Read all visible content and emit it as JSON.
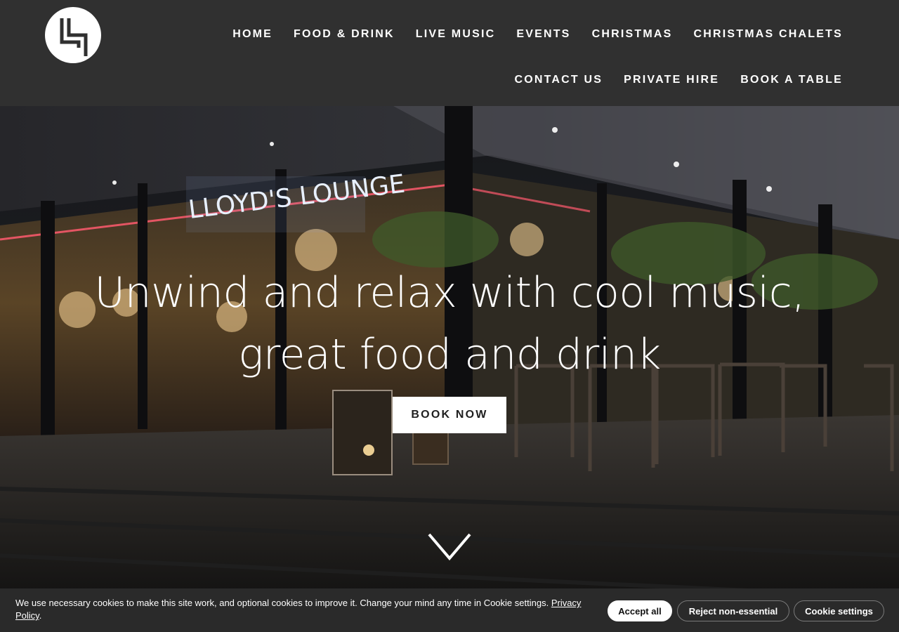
{
  "brand": {
    "logo_icon": "lloyds-lounge-logo-icon"
  },
  "nav": {
    "row1": [
      "HOME",
      "FOOD & DRINK",
      "LIVE MUSIC",
      "EVENTS",
      "CHRISTMAS",
      "CHRISTMAS CHALETS"
    ],
    "row2": [
      "CONTACT US",
      "PRIVATE HIRE",
      "BOOK A TABLE"
    ]
  },
  "hero": {
    "signage": "LLOYD'S LOUNGE",
    "title_line1": "Unwind and relax with cool music,",
    "title_line2": "great food and drink",
    "cta_label": "BOOK NOW",
    "scroll_icon": "chevron-down-icon"
  },
  "cookie_banner": {
    "text": "We use necessary cookies to make this site work, and optional cookies to improve it. Change your mind any time in Cookie settings.",
    "link_label": "Privacy Policy",
    "after_link": ".",
    "accept_label": "Accept all",
    "reject_label": "Reject non-essential",
    "settings_label": "Cookie settings"
  },
  "colors": {
    "header_bg": "#303030",
    "banner_bg": "#2a2a2a",
    "text_light": "#ffffff",
    "neon_red": "#ff5a6e"
  }
}
